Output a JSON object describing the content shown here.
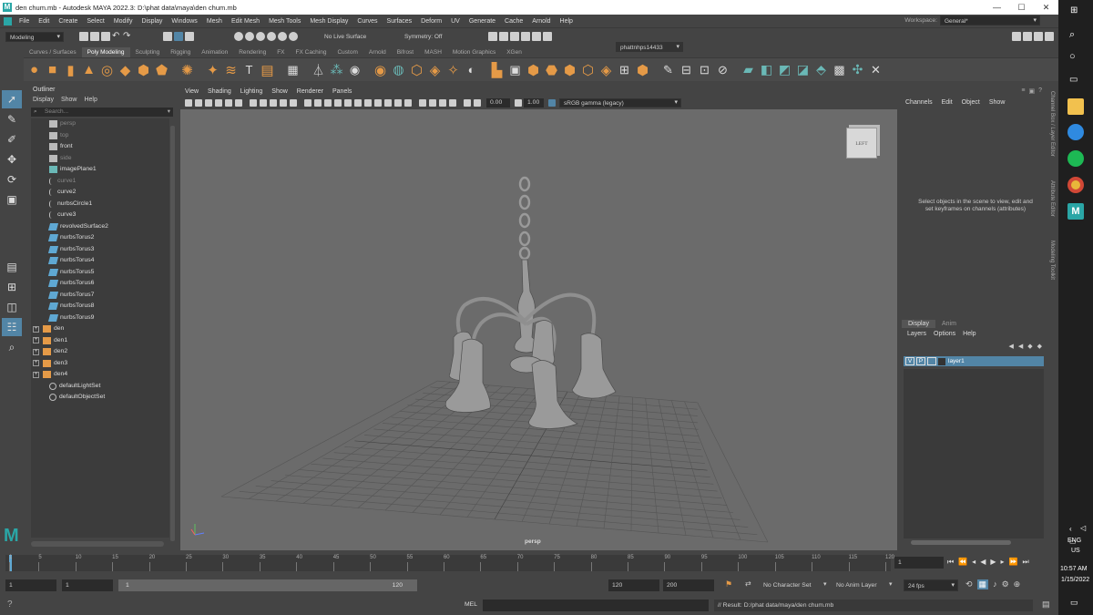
{
  "window": {
    "title": "den chum.mb - Autodesk MAYA 2022.3: D:\\phat data\\maya\\den chum.mb",
    "controls": [
      "—",
      "☐",
      "✕"
    ]
  },
  "menubar": {
    "items": [
      "File",
      "Edit",
      "Create",
      "Select",
      "Modify",
      "Display",
      "Windows",
      "Mesh",
      "Edit Mesh",
      "Mesh Tools",
      "Mesh Display",
      "Curves",
      "Surfaces",
      "Deform",
      "UV",
      "Generate",
      "Cache",
      "Arnold",
      "Help"
    ],
    "workspace_label": "Workspace:",
    "workspace_value": "General*"
  },
  "statusline": {
    "menuset": "Modeling",
    "live_surface": "No Live Surface",
    "symmetry": "Symmetry: Off",
    "user": "phattnhps14433"
  },
  "shelf": {
    "tabs": [
      "Curves / Surfaces",
      "Poly Modeling",
      "Sculpting",
      "Rigging",
      "Animation",
      "Rendering",
      "FX",
      "FX Caching",
      "Custom",
      "Arnold",
      "Bifrost",
      "MASH",
      "Motion Graphics",
      "XGen"
    ],
    "active_tab": "Poly Modeling"
  },
  "outliner": {
    "title": "Outliner",
    "menus": [
      "Display",
      "Show",
      "Help"
    ],
    "search_placeholder": "Search...",
    "items": [
      {
        "label": "persp",
        "type": "camera",
        "dim": true
      },
      {
        "label": "top",
        "type": "camera",
        "dim": true
      },
      {
        "label": "front",
        "type": "camera",
        "dim": false
      },
      {
        "label": "side",
        "type": "camera",
        "dim": true
      },
      {
        "label": "imagePlane1",
        "type": "plane",
        "dim": false
      },
      {
        "label": "curve1",
        "type": "curve",
        "dim": true
      },
      {
        "label": "curve2",
        "type": "curve",
        "dim": false
      },
      {
        "label": "nurbsCircle1",
        "type": "curve",
        "dim": false
      },
      {
        "label": "curve3",
        "type": "curve",
        "dim": false
      },
      {
        "label": "revolvedSurface2",
        "type": "surface",
        "dim": false
      },
      {
        "label": "nurbsTorus2",
        "type": "surface",
        "dim": false
      },
      {
        "label": "nurbsTorus3",
        "type": "surface",
        "dim": false
      },
      {
        "label": "nurbsTorus4",
        "type": "surface",
        "dim": false
      },
      {
        "label": "nurbsTorus5",
        "type": "surface",
        "dim": false
      },
      {
        "label": "nurbsTorus6",
        "type": "surface",
        "dim": false
      },
      {
        "label": "nurbsTorus7",
        "type": "surface",
        "dim": false
      },
      {
        "label": "nurbsTorus8",
        "type": "surface",
        "dim": false
      },
      {
        "label": "nurbsTorus9",
        "type": "surface",
        "dim": false
      },
      {
        "label": "den",
        "type": "group",
        "dim": false
      },
      {
        "label": "den1",
        "type": "group",
        "dim": false
      },
      {
        "label": "den2",
        "type": "group",
        "dim": false
      },
      {
        "label": "den3",
        "type": "group",
        "dim": false
      },
      {
        "label": "den4",
        "type": "group",
        "dim": false
      },
      {
        "label": "defaultLightSet",
        "type": "set",
        "dim": false
      },
      {
        "label": "defaultObjectSet",
        "type": "set",
        "dim": false
      }
    ]
  },
  "viewport": {
    "menus": [
      "View",
      "Shading",
      "Lighting",
      "Show",
      "Renderer",
      "Panels"
    ],
    "exposure": "0.00",
    "gamma": "1.00",
    "colorspace": "sRGB gamma (legacy)",
    "camera_label": "persp",
    "viewcube_label": "LEFT"
  },
  "channelbox": {
    "menus": [
      "Channels",
      "Edit",
      "Object",
      "Show"
    ],
    "message": "Select objects in the scene to view, edit and set keyframes on channels (attributes)"
  },
  "layereditor": {
    "tabs": [
      "Display",
      "Anim"
    ],
    "menus": [
      "Layers",
      "Options",
      "Help"
    ],
    "layer": {
      "v": "V",
      "p": "P",
      "name": "layer1"
    }
  },
  "sidestrip": {
    "labels": [
      "Channel Box / Layer Editor",
      "Attribute Editor",
      "Modeling Toolkit"
    ]
  },
  "timeline": {
    "ticks": [
      "1",
      "5",
      "10",
      "15",
      "20",
      "25",
      "30",
      "35",
      "40",
      "45",
      "50",
      "55",
      "60",
      "65",
      "70",
      "75",
      "80",
      "85",
      "90",
      "95",
      "100",
      "105",
      "110",
      "115",
      "120"
    ],
    "current_frame": "1"
  },
  "range": {
    "start": "1",
    "playback_start": "1",
    "slider_start": "1",
    "slider_end": "120",
    "playback_end": "120",
    "end": "200",
    "character_set": "No Character Set",
    "anim_layer": "No Anim Layer",
    "fps": "24 fps"
  },
  "cmdline": {
    "lang": "MEL",
    "result": "// Result: D:/phat data/maya/den chum.mb"
  },
  "taskbar": {
    "lang1": "ENG",
    "lang2": "US",
    "time": "10:57 AM",
    "date": "1/15/2022"
  }
}
